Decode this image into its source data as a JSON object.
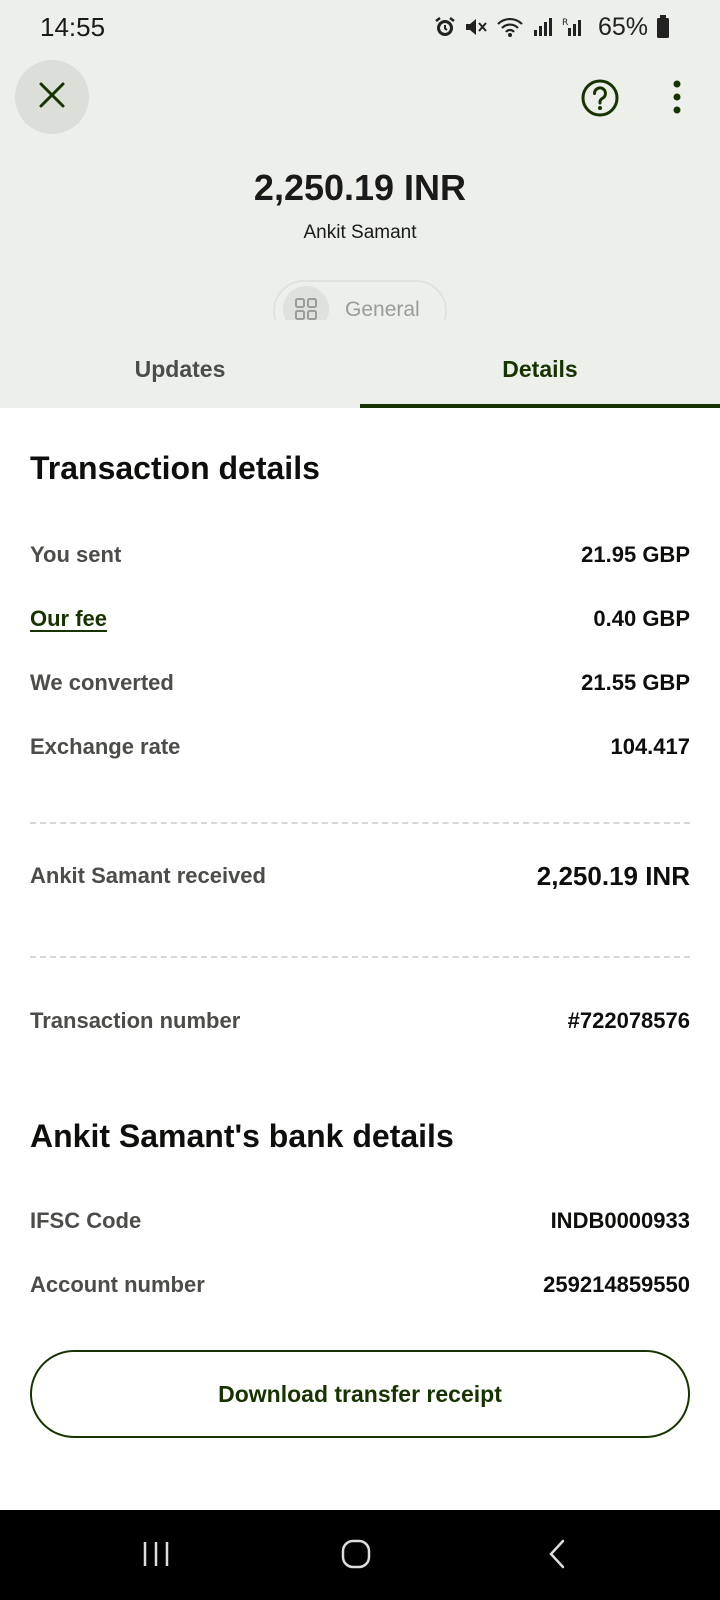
{
  "status_bar": {
    "time": "14:55",
    "battery": "65%",
    "icons": [
      "alarm-icon",
      "mute-icon",
      "wifi-icon",
      "signal-icon",
      "signal-icon-2",
      "battery-icon"
    ]
  },
  "header": {
    "amount": "2,250.19 INR",
    "recipient": "Ankit Samant",
    "category_chip": "General"
  },
  "tabs": [
    {
      "label": "Updates",
      "active": false
    },
    {
      "label": "Details",
      "active": true
    }
  ],
  "transaction": {
    "title": "Transaction details",
    "you_sent_label": "You sent",
    "you_sent_value": "21.95 GBP",
    "fee_label": "Our fee",
    "fee_value": "0.40 GBP",
    "converted_label": "We converted",
    "converted_value": "21.55 GBP",
    "rate_label": "Exchange rate",
    "rate_value": "104.417",
    "received_label": "Ankit Samant received",
    "received_value": "2,250.19 INR",
    "number_label": "Transaction number",
    "number_value": "#722078576"
  },
  "bank": {
    "title": "Ankit Samant's bank details",
    "ifsc_label": "IFSC Code",
    "ifsc_value": "INDB0000933",
    "account_label": "Account number",
    "account_value": "259214859550"
  },
  "actions": {
    "download_label": "Download transfer receipt"
  },
  "colors": {
    "accent": "#163300",
    "header_bg": "#edefea"
  }
}
